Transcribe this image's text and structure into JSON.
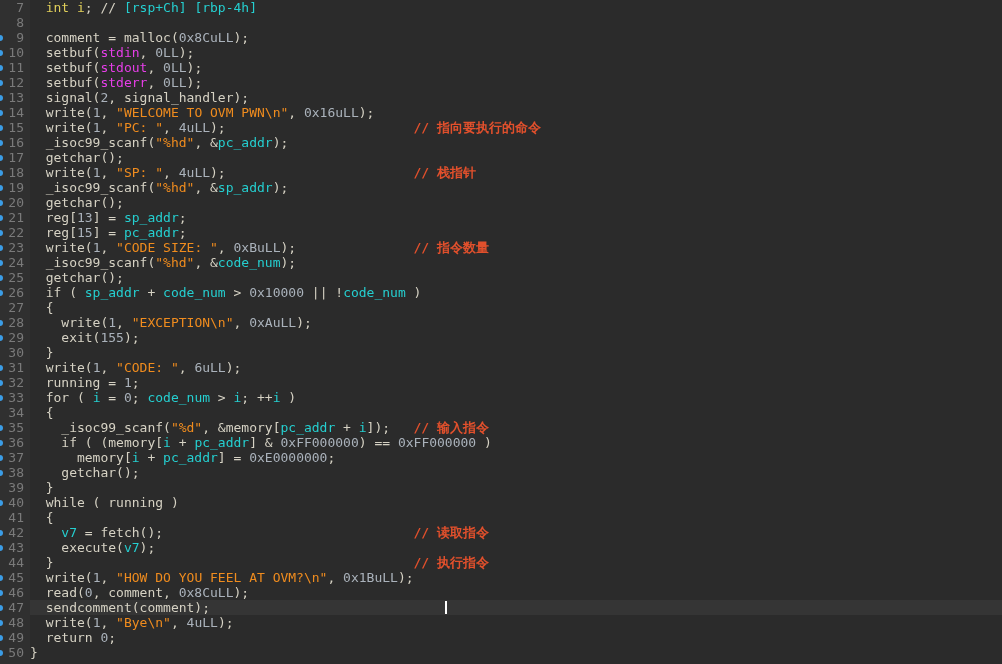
{
  "editor": {
    "lines": [
      {
        "number": "7",
        "marked": false,
        "current": false,
        "tokens": [
          {
            "kind": "keyword",
            "text": "  int i"
          },
          {
            "kind": "plain",
            "text": "; // "
          },
          {
            "kind": "var",
            "text": "[rsp+Ch] [rbp-4h]"
          }
        ]
      },
      {
        "number": "8",
        "marked": false,
        "current": false
      },
      {
        "number": "9",
        "marked": true,
        "current": false,
        "tokens": [
          {
            "kind": "plain",
            "text": "  comment = malloc("
          },
          {
            "kind": "number",
            "text": "0x8CuLL"
          },
          {
            "kind": "plain",
            "text": ");"
          }
        ]
      },
      {
        "number": "10",
        "marked": true,
        "current": false,
        "tokens": [
          {
            "kind": "plain",
            "text": "  setbuf("
          },
          {
            "kind": "global",
            "text": "stdin"
          },
          {
            "kind": "plain",
            "text": ", "
          },
          {
            "kind": "number",
            "text": "0LL"
          },
          {
            "kind": "plain",
            "text": ");"
          }
        ]
      },
      {
        "number": "11",
        "marked": true,
        "current": false,
        "tokens": [
          {
            "kind": "plain",
            "text": "  setbuf("
          },
          {
            "kind": "global",
            "text": "stdout"
          },
          {
            "kind": "plain",
            "text": ", "
          },
          {
            "kind": "number",
            "text": "0LL"
          },
          {
            "kind": "plain",
            "text": ");"
          }
        ]
      },
      {
        "number": "12",
        "marked": true,
        "current": false,
        "tokens": [
          {
            "kind": "plain",
            "text": "  setbuf("
          },
          {
            "kind": "global",
            "text": "stderr"
          },
          {
            "kind": "plain",
            "text": ", "
          },
          {
            "kind": "number",
            "text": "0LL"
          },
          {
            "kind": "plain",
            "text": ");"
          }
        ]
      },
      {
        "number": "13",
        "marked": true,
        "current": false,
        "tokens": [
          {
            "kind": "plain",
            "text": "  signal("
          },
          {
            "kind": "number",
            "text": "2"
          },
          {
            "kind": "plain",
            "text": ", signal_handler);"
          }
        ]
      },
      {
        "number": "14",
        "marked": true,
        "current": false,
        "tokens": [
          {
            "kind": "plain",
            "text": "  write("
          },
          {
            "kind": "number",
            "text": "1"
          },
          {
            "kind": "plain",
            "text": ", "
          },
          {
            "kind": "string",
            "text": "\"WELCOME TO OVM PWN\\n\""
          },
          {
            "kind": "plain",
            "text": ", "
          },
          {
            "kind": "number",
            "text": "0x16uLL"
          },
          {
            "kind": "plain",
            "text": ");"
          }
        ]
      },
      {
        "number": "15",
        "marked": true,
        "current": false,
        "tokens": [
          {
            "kind": "plain",
            "text": "  write("
          },
          {
            "kind": "number",
            "text": "1"
          },
          {
            "kind": "plain",
            "text": ", "
          },
          {
            "kind": "string",
            "text": "\"PC: \""
          },
          {
            "kind": "plain",
            "text": ", "
          },
          {
            "kind": "number",
            "text": "4uLL"
          },
          {
            "kind": "plain",
            "text": ");"
          }
        ],
        "comment": "// 指向要执行的命令"
      },
      {
        "number": "16",
        "marked": true,
        "current": false,
        "tokens": [
          {
            "kind": "plain",
            "text": "  _isoc99_scanf("
          },
          {
            "kind": "string",
            "text": "\"%hd\""
          },
          {
            "kind": "plain",
            "text": ", &"
          },
          {
            "kind": "var",
            "text": "pc_addr"
          },
          {
            "kind": "plain",
            "text": ");"
          }
        ]
      },
      {
        "number": "17",
        "marked": true,
        "current": false,
        "tokens": [
          {
            "kind": "plain",
            "text": "  getchar();"
          }
        ]
      },
      {
        "number": "18",
        "marked": true,
        "current": false,
        "tokens": [
          {
            "kind": "plain",
            "text": "  write("
          },
          {
            "kind": "number",
            "text": "1"
          },
          {
            "kind": "plain",
            "text": ", "
          },
          {
            "kind": "string",
            "text": "\"SP: \""
          },
          {
            "kind": "plain",
            "text": ", "
          },
          {
            "kind": "number",
            "text": "4uLL"
          },
          {
            "kind": "plain",
            "text": ");"
          }
        ],
        "comment": "// 栈指针"
      },
      {
        "number": "19",
        "marked": true,
        "current": false,
        "tokens": [
          {
            "kind": "plain",
            "text": "  _isoc99_scanf("
          },
          {
            "kind": "string",
            "text": "\"%hd\""
          },
          {
            "kind": "plain",
            "text": ", &"
          },
          {
            "kind": "var",
            "text": "sp_addr"
          },
          {
            "kind": "plain",
            "text": ");"
          }
        ]
      },
      {
        "number": "20",
        "marked": true,
        "current": false,
        "tokens": [
          {
            "kind": "plain",
            "text": "  getchar();"
          }
        ]
      },
      {
        "number": "21",
        "marked": true,
        "current": false,
        "tokens": [
          {
            "kind": "plain",
            "text": "  reg["
          },
          {
            "kind": "number",
            "text": "13"
          },
          {
            "kind": "plain",
            "text": "] = "
          },
          {
            "kind": "var",
            "text": "sp_addr"
          },
          {
            "kind": "plain",
            "text": ";"
          }
        ]
      },
      {
        "number": "22",
        "marked": true,
        "current": false,
        "tokens": [
          {
            "kind": "plain",
            "text": "  reg["
          },
          {
            "kind": "number",
            "text": "15"
          },
          {
            "kind": "plain",
            "text": "] = "
          },
          {
            "kind": "var",
            "text": "pc_addr"
          },
          {
            "kind": "plain",
            "text": ";"
          }
        ]
      },
      {
        "number": "23",
        "marked": true,
        "current": false,
        "tokens": [
          {
            "kind": "plain",
            "text": "  write("
          },
          {
            "kind": "number",
            "text": "1"
          },
          {
            "kind": "plain",
            "text": ", "
          },
          {
            "kind": "string",
            "text": "\"CODE SIZE: \""
          },
          {
            "kind": "plain",
            "text": ", "
          },
          {
            "kind": "number",
            "text": "0xBuLL"
          },
          {
            "kind": "plain",
            "text": ");"
          }
        ],
        "comment": "// 指令数量"
      },
      {
        "number": "24",
        "marked": true,
        "current": false,
        "tokens": [
          {
            "kind": "plain",
            "text": "  _isoc99_scanf("
          },
          {
            "kind": "string",
            "text": "\"%hd\""
          },
          {
            "kind": "plain",
            "text": ", &"
          },
          {
            "kind": "var",
            "text": "code_num"
          },
          {
            "kind": "plain",
            "text": ");"
          }
        ]
      },
      {
        "number": "25",
        "marked": true,
        "current": false,
        "tokens": [
          {
            "kind": "plain",
            "text": "  getchar();"
          }
        ]
      },
      {
        "number": "26",
        "marked": true,
        "current": false,
        "tokens": [
          {
            "kind": "plain",
            "text": "  if ( "
          },
          {
            "kind": "var",
            "text": "sp_addr"
          },
          {
            "kind": "plain",
            "text": " + "
          },
          {
            "kind": "var",
            "text": "code_num"
          },
          {
            "kind": "plain",
            "text": " > "
          },
          {
            "kind": "number",
            "text": "0x10000"
          },
          {
            "kind": "plain",
            "text": " || !"
          },
          {
            "kind": "var",
            "text": "code_num"
          },
          {
            "kind": "plain",
            "text": " )"
          }
        ]
      },
      {
        "number": "27",
        "marked": false,
        "current": false,
        "tokens": [
          {
            "kind": "plain",
            "text": "  {"
          }
        ]
      },
      {
        "number": "28",
        "marked": true,
        "current": false,
        "tokens": [
          {
            "kind": "plain",
            "text": "    write("
          },
          {
            "kind": "number",
            "text": "1"
          },
          {
            "kind": "plain",
            "text": ", "
          },
          {
            "kind": "string",
            "text": "\"EXCEPTION\\n\""
          },
          {
            "kind": "plain",
            "text": ", "
          },
          {
            "kind": "number",
            "text": "0xAuLL"
          },
          {
            "kind": "plain",
            "text": ");"
          }
        ]
      },
      {
        "number": "29",
        "marked": true,
        "current": false,
        "tokens": [
          {
            "kind": "plain",
            "text": "    exit("
          },
          {
            "kind": "number",
            "text": "155"
          },
          {
            "kind": "plain",
            "text": ");"
          }
        ]
      },
      {
        "number": "30",
        "marked": false,
        "current": false,
        "tokens": [
          {
            "kind": "plain",
            "text": "  }"
          }
        ]
      },
      {
        "number": "31",
        "marked": true,
        "current": false,
        "tokens": [
          {
            "kind": "plain",
            "text": "  write("
          },
          {
            "kind": "number",
            "text": "1"
          },
          {
            "kind": "plain",
            "text": ", "
          },
          {
            "kind": "string",
            "text": "\"CODE: \""
          },
          {
            "kind": "plain",
            "text": ", "
          },
          {
            "kind": "number",
            "text": "6uLL"
          },
          {
            "kind": "plain",
            "text": ");"
          }
        ]
      },
      {
        "number": "32",
        "marked": true,
        "current": false,
        "tokens": [
          {
            "kind": "plain",
            "text": "  running = "
          },
          {
            "kind": "number",
            "text": "1"
          },
          {
            "kind": "plain",
            "text": ";"
          }
        ]
      },
      {
        "number": "33",
        "marked": true,
        "current": false,
        "tokens": [
          {
            "kind": "plain",
            "text": "  for ( "
          },
          {
            "kind": "var",
            "text": "i"
          },
          {
            "kind": "plain",
            "text": " = "
          },
          {
            "kind": "number",
            "text": "0"
          },
          {
            "kind": "plain",
            "text": "; "
          },
          {
            "kind": "var",
            "text": "code_num"
          },
          {
            "kind": "plain",
            "text": " > "
          },
          {
            "kind": "var",
            "text": "i"
          },
          {
            "kind": "plain",
            "text": "; ++"
          },
          {
            "kind": "var",
            "text": "i"
          },
          {
            "kind": "plain",
            "text": " )"
          }
        ]
      },
      {
        "number": "34",
        "marked": false,
        "current": false,
        "tokens": [
          {
            "kind": "plain",
            "text": "  {"
          }
        ]
      },
      {
        "number": "35",
        "marked": true,
        "current": false,
        "tokens": [
          {
            "kind": "plain",
            "text": "    _isoc99_scanf("
          },
          {
            "kind": "string",
            "text": "\"%d\""
          },
          {
            "kind": "plain",
            "text": ", &memory["
          },
          {
            "kind": "var",
            "text": "pc_addr"
          },
          {
            "kind": "plain",
            "text": " + "
          },
          {
            "kind": "var",
            "text": "i"
          },
          {
            "kind": "plain",
            "text": "]);"
          }
        ],
        "comment": "// 输入指令"
      },
      {
        "number": "36",
        "marked": true,
        "current": false,
        "tokens": [
          {
            "kind": "plain",
            "text": "    if ( (memory["
          },
          {
            "kind": "var",
            "text": "i"
          },
          {
            "kind": "plain",
            "text": " + "
          },
          {
            "kind": "var",
            "text": "pc_addr"
          },
          {
            "kind": "plain",
            "text": "] & "
          },
          {
            "kind": "number",
            "text": "0xFF000000"
          },
          {
            "kind": "plain",
            "text": ") == "
          },
          {
            "kind": "number",
            "text": "0xFF000000"
          },
          {
            "kind": "plain",
            "text": " )"
          }
        ]
      },
      {
        "number": "37",
        "marked": true,
        "current": false,
        "tokens": [
          {
            "kind": "plain",
            "text": "      memory["
          },
          {
            "kind": "var",
            "text": "i"
          },
          {
            "kind": "plain",
            "text": " + "
          },
          {
            "kind": "var",
            "text": "pc_addr"
          },
          {
            "kind": "plain",
            "text": "] = "
          },
          {
            "kind": "number",
            "text": "0xE0000000"
          },
          {
            "kind": "plain",
            "text": ";"
          }
        ]
      },
      {
        "number": "38",
        "marked": true,
        "current": false,
        "tokens": [
          {
            "kind": "plain",
            "text": "    getchar();"
          }
        ]
      },
      {
        "number": "39",
        "marked": false,
        "current": false,
        "tokens": [
          {
            "kind": "plain",
            "text": "  }"
          }
        ]
      },
      {
        "number": "40",
        "marked": true,
        "current": false,
        "tokens": [
          {
            "kind": "plain",
            "text": "  while ( running )"
          }
        ]
      },
      {
        "number": "41",
        "marked": false,
        "current": false,
        "tokens": [
          {
            "kind": "plain",
            "text": "  {"
          }
        ]
      },
      {
        "number": "42",
        "marked": true,
        "current": false,
        "tokens": [
          {
            "kind": "var",
            "text": "    v7"
          },
          {
            "kind": "plain",
            "text": " = fetch();"
          }
        ],
        "comment": "// 读取指令"
      },
      {
        "number": "43",
        "marked": true,
        "current": false,
        "tokens": [
          {
            "kind": "plain",
            "text": "    execute("
          },
          {
            "kind": "var",
            "text": "v7"
          },
          {
            "kind": "plain",
            "text": ");"
          }
        ]
      },
      {
        "number": "44",
        "marked": false,
        "current": false,
        "tokens": [
          {
            "kind": "plain",
            "text": "  }"
          }
        ],
        "comment": "// 执行指令"
      },
      {
        "number": "45",
        "marked": true,
        "current": false,
        "tokens": [
          {
            "kind": "plain",
            "text": "  write("
          },
          {
            "kind": "number",
            "text": "1"
          },
          {
            "kind": "plain",
            "text": ", "
          },
          {
            "kind": "string",
            "text": "\"HOW DO YOU FEEL AT OVM?\\n\""
          },
          {
            "kind": "plain",
            "text": ", "
          },
          {
            "kind": "number",
            "text": "0x1BuLL"
          },
          {
            "kind": "plain",
            "text": ");"
          }
        ]
      },
      {
        "number": "46",
        "marked": true,
        "current": false,
        "tokens": [
          {
            "kind": "plain",
            "text": "  read("
          },
          {
            "kind": "number",
            "text": "0"
          },
          {
            "kind": "plain",
            "text": ", comment, "
          },
          {
            "kind": "number",
            "text": "0x8CuLL"
          },
          {
            "kind": "plain",
            "text": ");"
          }
        ]
      },
      {
        "number": "47",
        "marked": true,
        "current": true,
        "tokens": [
          {
            "kind": "plain",
            "text": "  sendcomment(comment);"
          }
        ]
      },
      {
        "number": "48",
        "marked": true,
        "current": false,
        "tokens": [
          {
            "kind": "plain",
            "text": "  write("
          },
          {
            "kind": "number",
            "text": "1"
          },
          {
            "kind": "plain",
            "text": ", "
          },
          {
            "kind": "string",
            "text": "\"Bye\\n\""
          },
          {
            "kind": "plain",
            "text": ", "
          },
          {
            "kind": "number",
            "text": "4uLL"
          },
          {
            "kind": "plain",
            "text": ");"
          }
        ]
      },
      {
        "number": "49",
        "marked": true,
        "current": false,
        "tokens": [
          {
            "kind": "plain",
            "text": "  return "
          },
          {
            "kind": "number",
            "text": "0"
          },
          {
            "kind": "plain",
            "text": ";"
          }
        ]
      },
      {
        "number": "50",
        "marked": true,
        "current": false,
        "tokens": [
          {
            "kind": "plain",
            "text": "}"
          }
        ]
      }
    ]
  }
}
